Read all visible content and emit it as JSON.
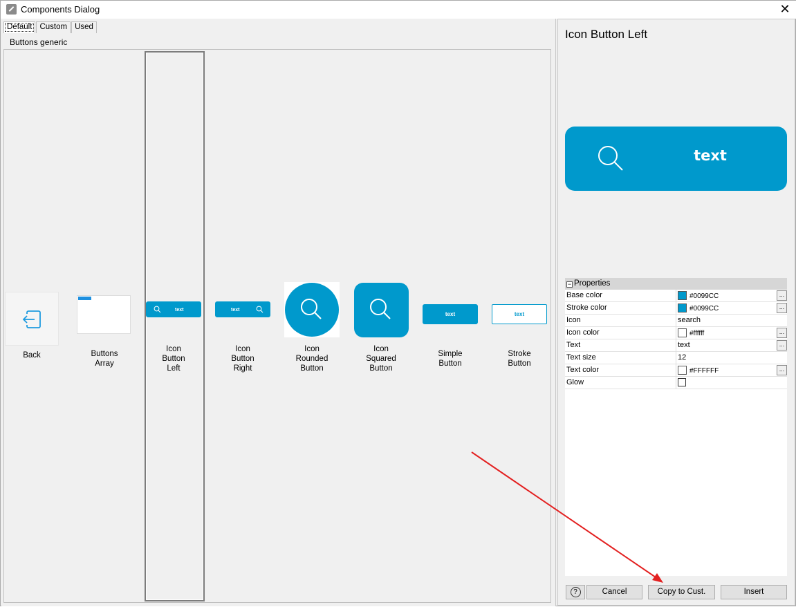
{
  "window": {
    "title": "Components Dialog"
  },
  "tabs": [
    {
      "label": "Default"
    },
    {
      "label": "Custom"
    },
    {
      "label": "Used"
    }
  ],
  "section": {
    "label": "Buttons generic"
  },
  "components": [
    {
      "label": "Back"
    },
    {
      "label": "Buttons\nArray"
    },
    {
      "label": "Icon\nButton\nLeft",
      "thumb_text": "text"
    },
    {
      "label": "Icon\nButton\nRight",
      "thumb_text": "text"
    },
    {
      "label": "Icon\nRounded\nButton"
    },
    {
      "label": "Icon\nSquared\nButton"
    },
    {
      "label": "Simple\nButton",
      "thumb_text": "text"
    },
    {
      "label": "Stroke\nButton",
      "thumb_text": "text"
    }
  ],
  "selected_component": "Icon Button Left",
  "preview": {
    "title": "Icon Button Left",
    "button_text": "text"
  },
  "properties": {
    "header": "Properties",
    "rows": [
      {
        "name": "Base color",
        "value": "#0099CC",
        "swatch": "#0099CC"
      },
      {
        "name": "Stroke color",
        "value": "#0099CC",
        "swatch": "#0099CC"
      },
      {
        "name": "Icon",
        "value": "search"
      },
      {
        "name": "Icon color",
        "value": "#ffffff",
        "swatch": "#ffffff"
      },
      {
        "name": "Text",
        "value": "text"
      },
      {
        "name": "Text size",
        "value": "12"
      },
      {
        "name": "Text color",
        "value": "#FFFFFF",
        "swatch": "#FFFFFF"
      },
      {
        "name": "Glow",
        "value": ""
      }
    ]
  },
  "buttons": {
    "cancel": "Cancel",
    "copy": "Copy to Cust.",
    "insert": "Insert",
    "ellipsis": "...",
    "help": "?"
  },
  "colors": {
    "accent": "#0099CC",
    "annotation_arrow": "#e32020"
  },
  "icons": {
    "title": "pencil-icon",
    "close": "close-icon",
    "back": "back-arrow-icon",
    "search": "search-icon",
    "help": "help-icon"
  }
}
